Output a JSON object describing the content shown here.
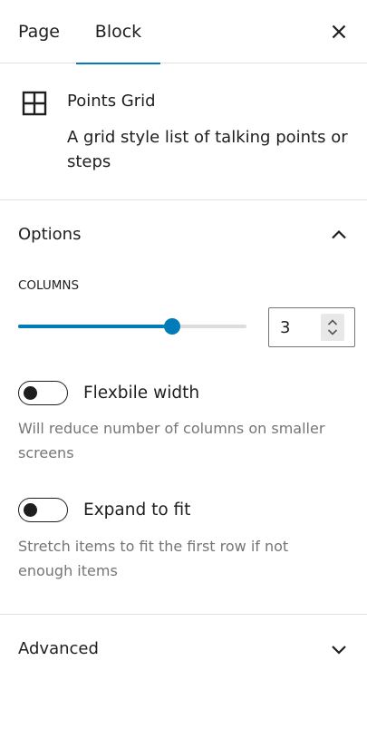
{
  "tabs": [
    {
      "label": "Page",
      "active": false
    },
    {
      "label": "Block",
      "active": true
    }
  ],
  "close_icon": "close-icon",
  "accent_color": "#007cba",
  "block": {
    "icon": "grid-icon",
    "title": "Points Grid",
    "description": "A grid style list of talking points or steps"
  },
  "options_panel": {
    "title": "Options",
    "expanded": true,
    "columns": {
      "label": "Columns",
      "value": "3",
      "slider_fraction": 0.675
    },
    "flexible_width": {
      "label": "Flexbile width",
      "checked": false,
      "help": "Will reduce number of columns on smaller screens"
    },
    "expand_to_fit": {
      "label": "Expand to fit",
      "checked": false,
      "help": "Stretch items to fit the first row if not enough items"
    }
  },
  "advanced_panel": {
    "title": "Advanced",
    "expanded": false
  }
}
